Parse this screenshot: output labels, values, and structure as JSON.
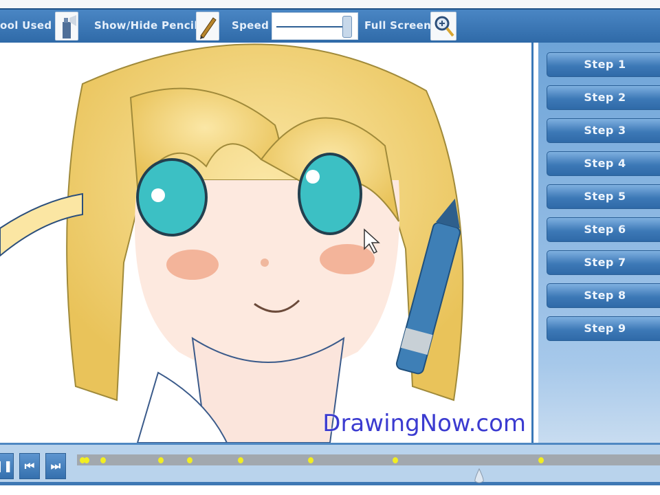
{
  "toolbar": {
    "tool_used_label": "ool Used",
    "show_hide_pencil_label": "Show/Hide Pencil",
    "speed_label": "Speed",
    "speed_value": 1.0,
    "full_screen_label": "Full Screen"
  },
  "canvas": {
    "watermark": "DrawingNow.com"
  },
  "steps": [
    "Step 1",
    "Step 2",
    "Step 3",
    "Step 4",
    "Step 5",
    "Step 6",
    "Step 7",
    "Step 8",
    "Step 9"
  ],
  "playback": {
    "pause_symbol": "❚❚",
    "prev_symbol": "⏮",
    "next_symbol": "⏭",
    "progress": 0.69
  },
  "colors": {
    "accent": "#3a78b8",
    "keyframe": "#f2ee22",
    "watermark": "#3b3bd0"
  }
}
